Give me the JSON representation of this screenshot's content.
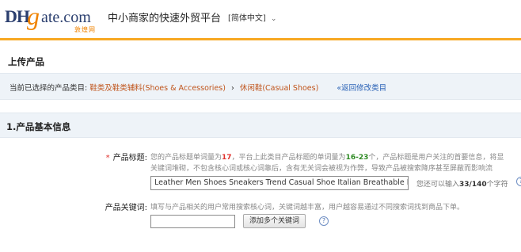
{
  "header": {
    "logo": {
      "dh": "DH",
      "g": "g",
      "ate": "ate.com",
      "cn": "敦煌网"
    },
    "slogan": "中小商家的快速外贸平台",
    "language": "[简体中文]",
    "language_icon": "chevron-down-icon",
    "accent_color": "#f7a823"
  },
  "page": {
    "title": "上传产品"
  },
  "category": {
    "label": "当前已选择的产品类目:",
    "level1": "鞋类及鞋类辅料(Shoes & Accessories)",
    "separator": "›",
    "level2": "休闲鞋(Casual Shoes)",
    "back_link": "«返回修改类目"
  },
  "section": {
    "title": "1.产品基本信息"
  },
  "product_title": {
    "required_mark": "*",
    "label": "产品标题:",
    "hint1_a": "您的产品标题单词量为",
    "hint1_count": "17",
    "hint1_b": "，平台上此类目产品标题的单词量为",
    "hint1_range": "16-23",
    "hint1_c": "个，产品标题是用户关注的首要信息，将显",
    "hint2": "关键词堆砌，不包含核心词或核心词靠后，含有无关词会被视为作弊，导致产品被搜索降序甚至屏蔽而影响流",
    "value": "Leather Men Shoes Sneakers Trend Casual Shoe Italian Breathable Leisure Male",
    "remain_a": "您还可以输入",
    "remain_value": "33/140",
    "remain_b": "个字符"
  },
  "keywords": {
    "label": "产品关键词:",
    "hint": "填写与产品相关的用户常用搜索核心词，关键词越丰富，用户越容易通过不同搜索词找到商品下单。",
    "value": "",
    "button": "添加多个关键词",
    "help_glyph": "?"
  }
}
